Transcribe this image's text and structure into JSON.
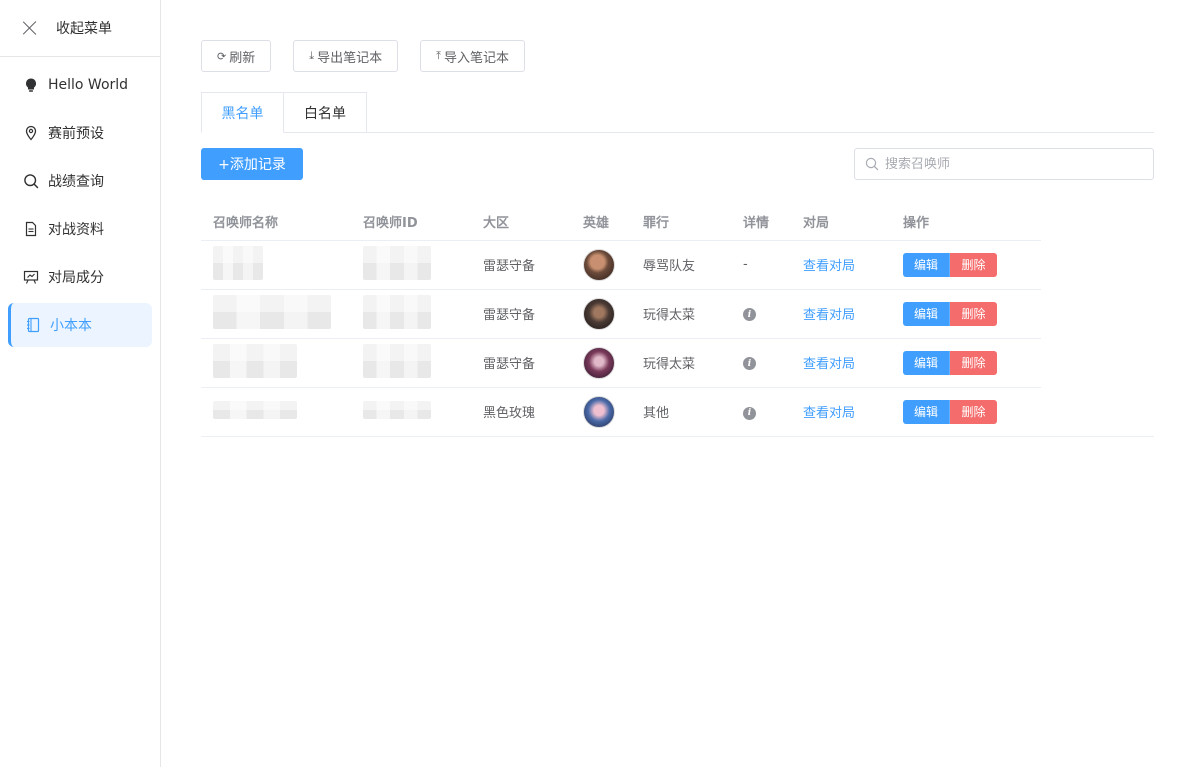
{
  "sidebar": {
    "collapse_label": "收起菜单",
    "items": [
      {
        "label": "Hello World",
        "icon": "lightbulb-icon"
      },
      {
        "label": "赛前预设",
        "icon": "location-icon"
      },
      {
        "label": "战绩查询",
        "icon": "search-icon"
      },
      {
        "label": "对战资料",
        "icon": "document-icon"
      },
      {
        "label": "对局成分",
        "icon": "presentation-icon"
      },
      {
        "label": "小本本",
        "icon": "notebook-icon",
        "active": true
      }
    ]
  },
  "toolbar": {
    "refresh_label": "刷新",
    "export_label": "导出笔记本",
    "import_label": "导入笔记本"
  },
  "tabs": [
    {
      "label": "黑名单",
      "active": true
    },
    {
      "label": "白名单",
      "active": false
    }
  ],
  "add_button_label": "+添加记录",
  "search": {
    "placeholder": "搜索召唤师"
  },
  "table": {
    "headers": [
      "召唤师名称",
      "召唤师ID",
      "大区",
      "英雄",
      "罪行",
      "详情",
      "对局",
      "操作"
    ],
    "rows": [
      {
        "server": "雷瑟守备",
        "crime": "辱骂队友",
        "detail": "-",
        "has_info": false,
        "match_link": "查看对局",
        "edit": "编辑",
        "delete": "删除",
        "avatar_color": "#6b4a3a"
      },
      {
        "server": "雷瑟守备",
        "crime": "玩得太菜",
        "detail": "",
        "has_info": true,
        "match_link": "查看对局",
        "edit": "编辑",
        "delete": "删除",
        "avatar_color": "#4a3a34"
      },
      {
        "server": "雷瑟守备",
        "crime": "玩得太菜",
        "detail": "",
        "has_info": true,
        "match_link": "查看对局",
        "edit": "编辑",
        "delete": "删除",
        "avatar_color": "#7a3a5a"
      },
      {
        "server": "黑色玫瑰",
        "crime": "其他",
        "detail": "",
        "has_info": true,
        "match_link": "查看对局",
        "edit": "编辑",
        "delete": "删除",
        "avatar_color": "#4a6aa8"
      }
    ]
  },
  "colors": {
    "primary": "#409eff",
    "danger": "#f56c6c"
  }
}
